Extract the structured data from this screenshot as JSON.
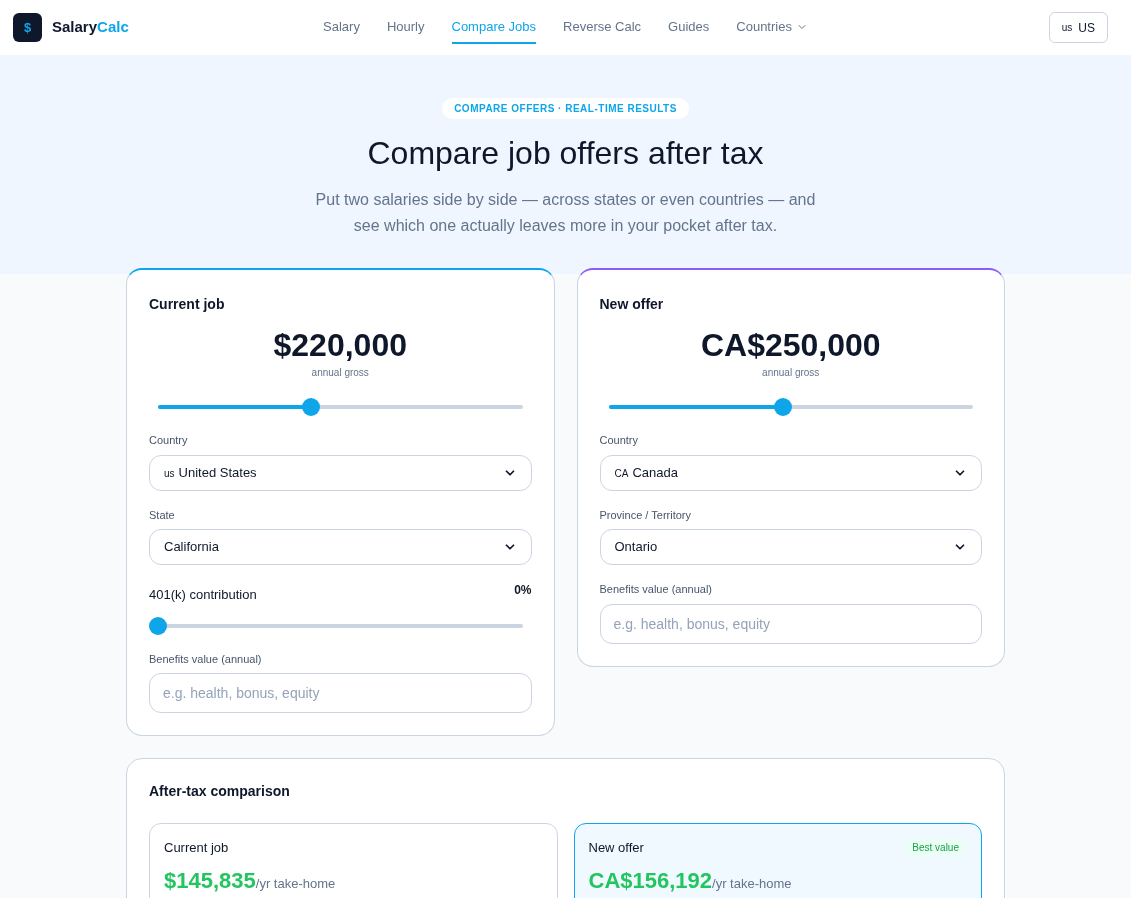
{
  "nav": {
    "logo_symbol": "$",
    "brand": "Salary",
    "brand_accent": "Calc",
    "links": [
      {
        "label": "Salary",
        "selected": false,
        "menu": false
      },
      {
        "label": "Hourly",
        "selected": false,
        "menu": false
      },
      {
        "label": "Compare Jobs",
        "selected": true,
        "menu": false
      },
      {
        "label": "Reverse Calc",
        "selected": false,
        "menu": false
      },
      {
        "label": "Guides",
        "selected": false,
        "menu": false
      },
      {
        "label": "Countries",
        "selected": false,
        "menu": true
      }
    ],
    "region": {
      "flag": "us",
      "label": "US"
    }
  },
  "hero": {
    "badge": "COMPARE OFFERS · REAL-TIME RESULTS",
    "title": "Compare job offers after tax",
    "subtitle": "Put two salaries side by side — across states or even countries — and see which one actually leaves more in your pocket after tax."
  },
  "jobs": [
    {
      "title": "Current job",
      "color": "#0ea5e9",
      "amount": "$220,000",
      "caption": "annual gross",
      "level": 0.42,
      "fields": [
        {
          "kind": "select",
          "label": "Country",
          "flag": "us",
          "value": "United States"
        },
        {
          "kind": "select",
          "label": "State",
          "value": "California"
        },
        {
          "kind": "slider",
          "label": "401(k) contribution",
          "reading": "0%",
          "level": 0
        },
        {
          "kind": "input",
          "label": "Benefits value (annual)",
          "placeholder": "e.g. health, bonus, equity"
        }
      ]
    },
    {
      "title": "New offer",
      "color": "#8b5cf6",
      "amount": "CA$250,000",
      "caption": "annual gross",
      "level": 0.48,
      "fields": [
        {
          "kind": "select",
          "label": "Country",
          "flag": "CA",
          "value": "Canada"
        },
        {
          "kind": "select",
          "label": "Province / Territory",
          "value": "Ontario"
        },
        {
          "kind": "input",
          "label": "Benefits value (annual)",
          "placeholder": "e.g. health, bonus, equity"
        }
      ]
    }
  ],
  "comparison": {
    "title": "After-tax comparison",
    "results": [
      {
        "title": "Current job",
        "amount": "$145,835",
        "suffix": "/yr take-home",
        "best": false
      },
      {
        "title": "New offer",
        "amount": "CA$156,192",
        "suffix": "/yr take-home",
        "best": true,
        "badge": "Best value"
      }
    ]
  }
}
